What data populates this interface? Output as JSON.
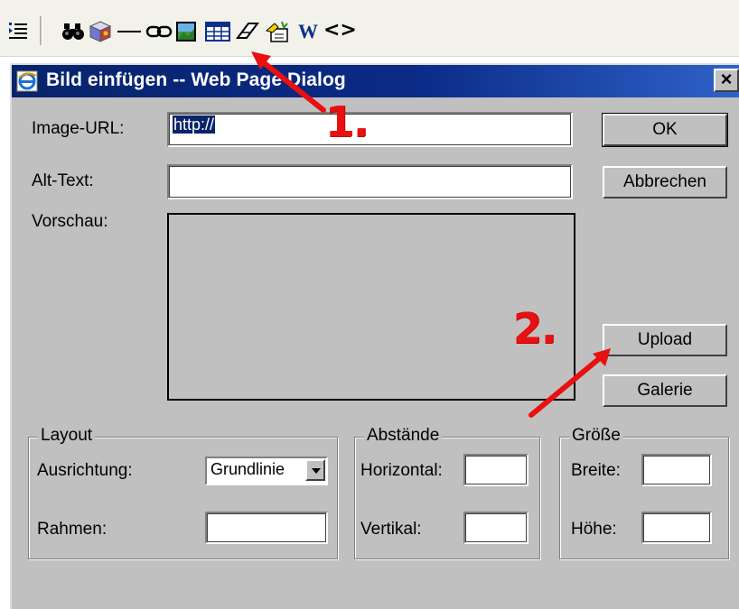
{
  "toolbar": {
    "icons": [
      "indent-icon",
      "find-binoculars-icon",
      "3d-box-icon",
      "horizontal-rule-icon",
      "hyperlink-icon",
      "insert-image-icon",
      "insert-table-icon",
      "eraser-icon",
      "wizard-hand-icon",
      "word-icon",
      "source-code-icon"
    ],
    "word_label": "W",
    "code_label": "<>"
  },
  "dialog": {
    "title": "Bild einfügen -- Web Page Dialog",
    "close_label": "×",
    "image_url": {
      "label": "Image-URL:",
      "value": "http://"
    },
    "alt_text": {
      "label": "Alt-Text:",
      "value": ""
    },
    "preview": {
      "label": "Vorschau:"
    },
    "buttons": {
      "ok": "OK",
      "cancel": "Abbrechen",
      "upload": "Upload",
      "gallery": "Galerie"
    },
    "layout": {
      "legend": "Layout",
      "alignment_label": "Ausrichtung:",
      "alignment_value": "Grundlinie",
      "border_label": "Rahmen:",
      "border_value": ""
    },
    "spacing": {
      "legend": "Abstände",
      "horizontal_label": "Horizontal:",
      "horizontal_value": "",
      "vertical_label": "Vertikal:",
      "vertical_value": ""
    },
    "size": {
      "legend": "Größe",
      "width_label": "Breite:",
      "width_value": "",
      "height_label": "Höhe:",
      "height_value": ""
    }
  },
  "annotations": {
    "step1": "1.",
    "step2": "2.",
    "color": "#e81010"
  }
}
